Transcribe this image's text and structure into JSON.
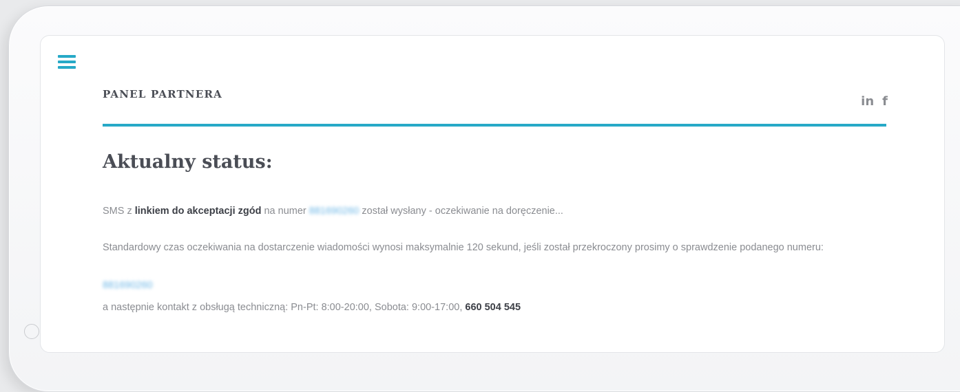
{
  "header": {
    "menu_icon": "hamburger-menu-icon",
    "title": "PANEL PARTNERA",
    "social": [
      {
        "name": "linkedin-icon",
        "label": "in"
      },
      {
        "name": "facebook-icon",
        "label": "f"
      }
    ]
  },
  "main": {
    "heading": "Aktualny status:",
    "sms_prefix": "SMS z",
    "sms_link_text": "linkiem do akceptacji zgód",
    "sms_mid": "na numer",
    "phone_number": "881690260",
    "sms_suffix": "został wysłany - oczekiwanie na doręczenie...",
    "info_text": "Standardowy czas oczekiwania na dostarczenie wiadomości wynosi maksymalnie 120 sekund, jeśli został przekroczony prosimy o sprawdzenie podanego numeru:",
    "phone_number_again": "881690260",
    "contact_text": "a następnie kontakt z obsługą techniczną: Pn-Pt: 8:00-20:00, Sobota: 9:00-17:00,",
    "support_phone": "660 504 545"
  },
  "colors": {
    "accent": "#27a9c7",
    "heading": "#4a4d55",
    "body_text": "#8a8c91"
  }
}
